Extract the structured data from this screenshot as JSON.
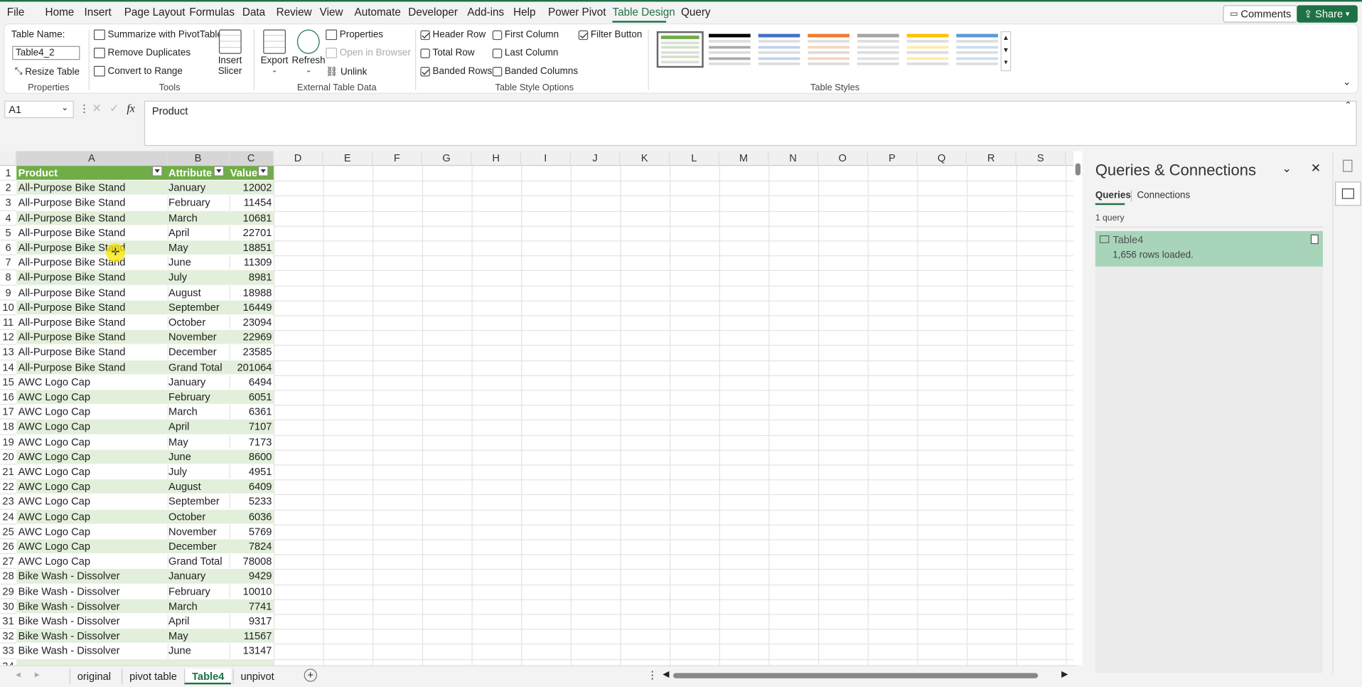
{
  "menu": {
    "items": [
      "File",
      "Home",
      "Insert",
      "Page Layout",
      "Formulas",
      "Data",
      "Review",
      "View",
      "Automate",
      "Developer",
      "Add-ins",
      "Help",
      "Power Pivot",
      "Table Design",
      "Query"
    ],
    "active": "Table Design",
    "comments": "Comments",
    "share": "Share"
  },
  "ribbon": {
    "properties": {
      "table_name_label": "Table Name:",
      "table_name_value": "Table4_2",
      "resize": "Resize Table",
      "group": "Properties"
    },
    "tools": {
      "summarize": "Summarize with PivotTable",
      "remove_dup": "Remove Duplicates",
      "convert": "Convert to Range",
      "group": "Tools"
    },
    "slicer": {
      "line1": "Insert",
      "line2": "Slicer"
    },
    "external": {
      "export": "Export",
      "refresh": "Refresh",
      "properties": "Properties",
      "open_browser": "Open in Browser",
      "unlink": "Unlink",
      "group": "External Table Data"
    },
    "options": {
      "header_row": "Header Row",
      "total_row": "Total Row",
      "banded_rows": "Banded Rows",
      "first_col": "First Column",
      "last_col": "Last Column",
      "banded_cols": "Banded Columns",
      "filter_btn": "Filter Button",
      "group": "Table Style Options",
      "checked": {
        "header_row": true,
        "total_row": false,
        "banded_rows": true,
        "first_col": false,
        "last_col": false,
        "banded_cols": false,
        "filter_btn": true
      }
    },
    "styles": {
      "group": "Table Styles",
      "colors": [
        "#70ad47",
        "#000000",
        "#4472c4",
        "#ed7d31",
        "#a5a5a5",
        "#ffc000",
        "#5b9bd5"
      ]
    }
  },
  "formula": {
    "namebox": "A1",
    "fx": "fx",
    "content": "Product"
  },
  "sheet": {
    "columns": [
      "A",
      "B",
      "C",
      "D",
      "E",
      "F",
      "G",
      "H",
      "I",
      "J",
      "K",
      "L",
      "M",
      "N",
      "O",
      "P",
      "Q",
      "R",
      "S"
    ],
    "header": [
      "Product",
      "Attribute",
      "Value"
    ],
    "rows": [
      [
        "All-Purpose Bike Stand",
        "January",
        "12002"
      ],
      [
        "All-Purpose Bike Stand",
        "February",
        "11454"
      ],
      [
        "All-Purpose Bike Stand",
        "March",
        "10681"
      ],
      [
        "All-Purpose Bike Stand",
        "April",
        "22701"
      ],
      [
        "All-Purpose Bike Stand",
        "May",
        "18851"
      ],
      [
        "All-Purpose Bike Stand",
        "June",
        "11309"
      ],
      [
        "All-Purpose Bike Stand",
        "July",
        "8981"
      ],
      [
        "All-Purpose Bike Stand",
        "August",
        "18988"
      ],
      [
        "All-Purpose Bike Stand",
        "September",
        "16449"
      ],
      [
        "All-Purpose Bike Stand",
        "October",
        "23094"
      ],
      [
        "All-Purpose Bike Stand",
        "November",
        "22969"
      ],
      [
        "All-Purpose Bike Stand",
        "December",
        "23585"
      ],
      [
        "All-Purpose Bike Stand",
        "Grand Total",
        "201064"
      ],
      [
        "AWC Logo Cap",
        "January",
        "6494"
      ],
      [
        "AWC Logo Cap",
        "February",
        "6051"
      ],
      [
        "AWC Logo Cap",
        "March",
        "6361"
      ],
      [
        "AWC Logo Cap",
        "April",
        "7107"
      ],
      [
        "AWC Logo Cap",
        "May",
        "7173"
      ],
      [
        "AWC Logo Cap",
        "June",
        "8600"
      ],
      [
        "AWC Logo Cap",
        "July",
        "4951"
      ],
      [
        "AWC Logo Cap",
        "August",
        "6409"
      ],
      [
        "AWC Logo Cap",
        "September",
        "5233"
      ],
      [
        "AWC Logo Cap",
        "October",
        "6036"
      ],
      [
        "AWC Logo Cap",
        "November",
        "5769"
      ],
      [
        "AWC Logo Cap",
        "December",
        "7824"
      ],
      [
        "AWC Logo Cap",
        "Grand Total",
        "78008"
      ],
      [
        "Bike Wash - Dissolver",
        "January",
        "9429"
      ],
      [
        "Bike Wash - Dissolver",
        "February",
        "10010"
      ],
      [
        "Bike Wash - Dissolver",
        "March",
        "7741"
      ],
      [
        "Bike Wash - Dissolver",
        "April",
        "9317"
      ],
      [
        "Bike Wash - Dissolver",
        "May",
        "11567"
      ],
      [
        "Bike Wash - Dissolver",
        "June",
        "13147"
      ]
    ]
  },
  "tabs": {
    "items": [
      "original",
      "pivot table",
      "Table4",
      "unpivot"
    ],
    "active": "Table4"
  },
  "pane": {
    "title": "Queries & Connections",
    "tab_queries": "Queries",
    "tab_connections": "Connections",
    "count": "1 query",
    "query_name": "Table4",
    "query_status": "1,656 rows loaded."
  }
}
